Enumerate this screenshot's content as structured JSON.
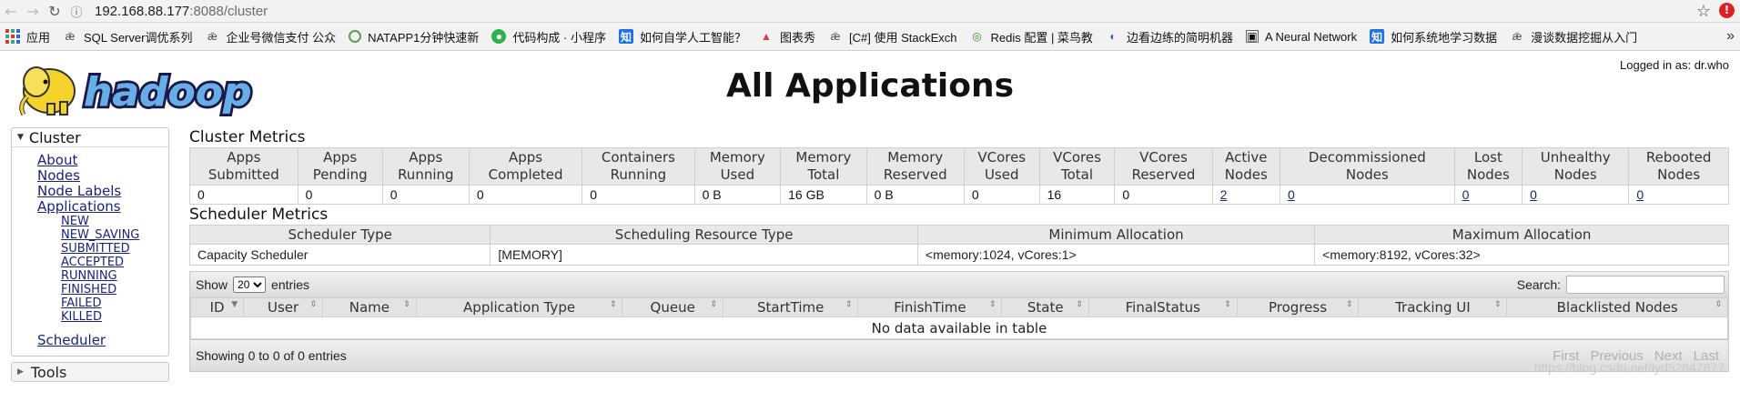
{
  "browser": {
    "url_host": "192.168.88.177",
    "url_rest": ":8088/cluster",
    "bookmarks": [
      {
        "label": "应用",
        "icon": "apps-grid-icon"
      },
      {
        "label": "SQL Server调优系列",
        "icon": "feather-icon"
      },
      {
        "label": "企业号微信支付 公众",
        "icon": "feather-icon"
      },
      {
        "label": "NATAPP1分钟快速新",
        "icon": "ring-icon"
      },
      {
        "label": "代码构成 · 小程序",
        "icon": "wechat-icon"
      },
      {
        "label": "如何自学人工智能？",
        "icon": "zhihu-icon"
      },
      {
        "label": "图表秀",
        "icon": "chart-icon"
      },
      {
        "label": "[C#] 使用 StackExch",
        "icon": "feather-icon"
      },
      {
        "label": "Redis 配置 | 菜鸟教",
        "icon": "globe-icon"
      },
      {
        "label": "边看边练的简明机器",
        "icon": "blue-icon"
      },
      {
        "label": "A Neural Network",
        "icon": "box-icon"
      },
      {
        "label": "如何系统地学习数据",
        "icon": "zhihu-icon"
      },
      {
        "label": "漫谈数据挖掘从入门",
        "icon": "feather-icon"
      }
    ]
  },
  "header": {
    "title": "All Applications",
    "logo_text": "hadoop",
    "login": "Logged in as: dr.who"
  },
  "sidebar": {
    "cluster_label": "Cluster",
    "links": [
      "About",
      "Nodes",
      "Node Labels",
      "Applications"
    ],
    "app_states": [
      "NEW",
      "NEW_SAVING",
      "SUBMITTED",
      "ACCEPTED",
      "RUNNING",
      "FINISHED",
      "FAILED",
      "KILLED"
    ],
    "scheduler": "Scheduler",
    "tools_label": "Tools"
  },
  "cluster_metrics": {
    "title": "Cluster Metrics",
    "columns": [
      [
        "Apps",
        "Submitted"
      ],
      [
        "Apps",
        "Pending"
      ],
      [
        "Apps",
        "Running"
      ],
      [
        "Apps",
        "Completed"
      ],
      [
        "Containers",
        "Running"
      ],
      [
        "Memory",
        "Used"
      ],
      [
        "Memory",
        "Total"
      ],
      [
        "Memory",
        "Reserved"
      ],
      [
        "VCores",
        "Used"
      ],
      [
        "VCores",
        "Total"
      ],
      [
        "VCores",
        "Reserved"
      ],
      [
        "Active",
        "Nodes"
      ],
      [
        "Decommissioned",
        "Nodes"
      ],
      [
        "Lost",
        "Nodes"
      ],
      [
        "Unhealthy",
        "Nodes"
      ],
      [
        "Rebooted",
        "Nodes"
      ]
    ],
    "values": [
      "0",
      "0",
      "0",
      "0",
      "0",
      "0 B",
      "16 GB",
      "0 B",
      "0",
      "16",
      "0",
      "2",
      "0",
      "0",
      "0",
      "0"
    ],
    "linked": [
      false,
      false,
      false,
      false,
      false,
      false,
      false,
      false,
      false,
      false,
      false,
      true,
      true,
      true,
      true,
      true
    ]
  },
  "scheduler_metrics": {
    "title": "Scheduler Metrics",
    "columns": [
      "Scheduler Type",
      "Scheduling Resource Type",
      "Minimum Allocation",
      "Maximum Allocation"
    ],
    "values": [
      "Capacity Scheduler",
      "[MEMORY]",
      "<memory:1024, vCores:1>",
      "<memory:8192, vCores:32>"
    ]
  },
  "apps_table": {
    "show_label": "Show",
    "entries_label": "entries",
    "page_size": "20",
    "search_label": "Search:",
    "columns": [
      "ID",
      "User",
      "Name",
      "Application Type",
      "Queue",
      "StartTime",
      "FinishTime",
      "State",
      "FinalStatus",
      "Progress",
      "Tracking UI",
      "Blacklisted Nodes"
    ],
    "empty_text": "No data available in table",
    "info": "Showing 0 to 0 of 0 entries",
    "pager": [
      "First",
      "Previous",
      "Next",
      "Last"
    ]
  },
  "watermark": "https://blog.csdn.net/lyd52847677"
}
